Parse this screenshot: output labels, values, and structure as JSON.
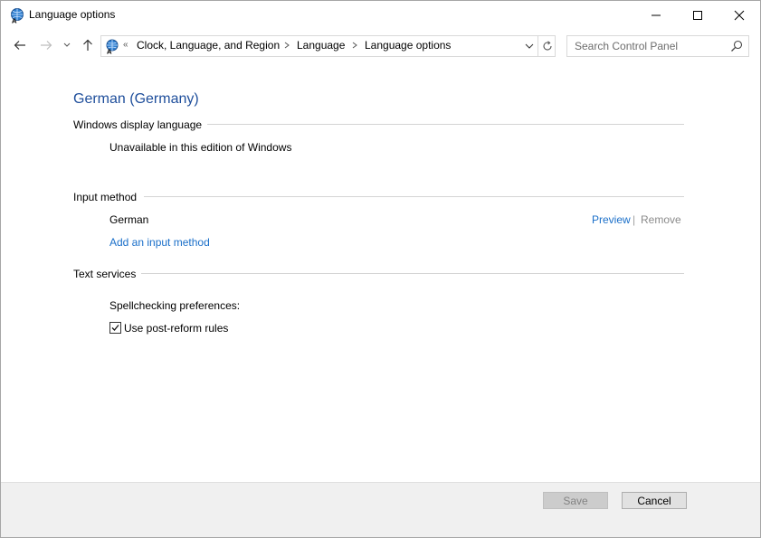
{
  "window": {
    "title": "Language options"
  },
  "nav": {
    "breadcrumb_overflow": "«",
    "breadcrumbs": [
      {
        "label": "Clock, Language, and Region"
      },
      {
        "label": "Language"
      },
      {
        "label": "Language options"
      }
    ],
    "search_placeholder": "Search Control Panel"
  },
  "page": {
    "title": "German (Germany)",
    "display_language": {
      "heading": "Windows display language",
      "status": "Unavailable in this edition of Windows"
    },
    "input_method": {
      "heading": "Input method",
      "methods": [
        {
          "name": "German",
          "preview_label": "Preview",
          "separator": "|",
          "remove_label": "Remove"
        }
      ],
      "add_link": "Add an input method"
    },
    "text_services": {
      "heading": "Text services",
      "spellcheck_label": "Spellchecking preferences:",
      "post_reform": {
        "label": "Use post-reform rules",
        "checked": true
      }
    }
  },
  "footer": {
    "save_label": "Save",
    "cancel_label": "Cancel"
  },
  "colors": {
    "title_blue": "#1e4e9b",
    "link_blue": "#1a6fc9",
    "footer_bg": "#f0f0f0"
  }
}
